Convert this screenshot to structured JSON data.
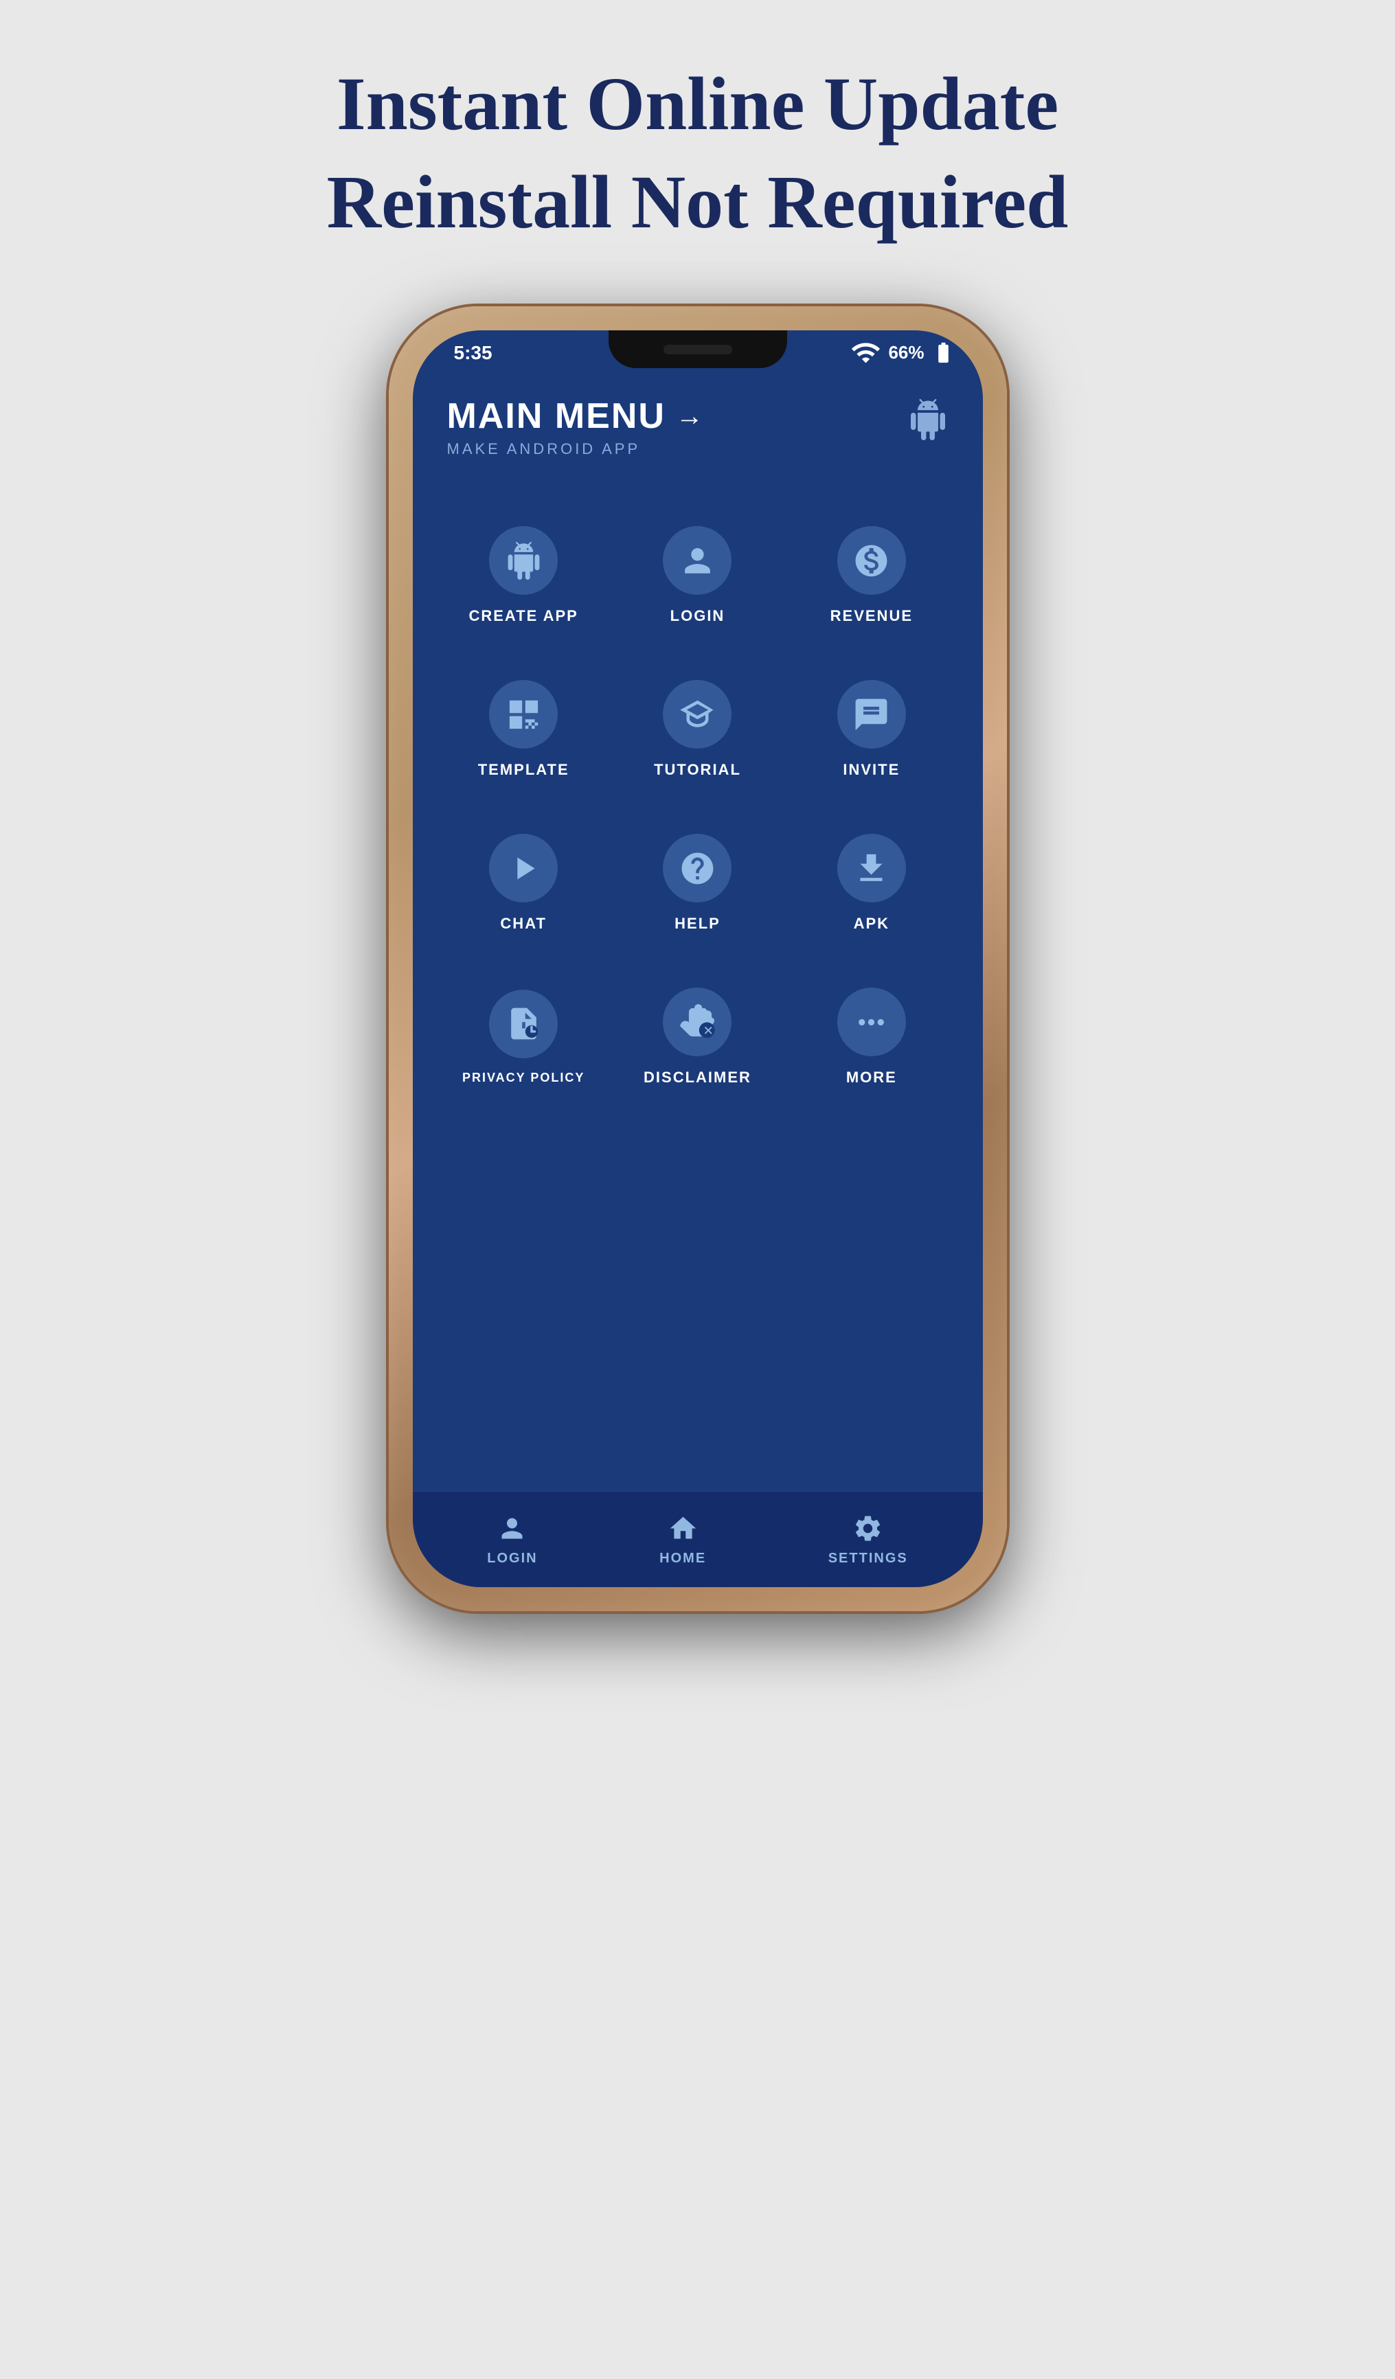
{
  "page": {
    "headline_line1": "Instant Online Update",
    "headline_line2": "Reinstall Not Required",
    "bg_color": "#e8e8e8",
    "text_color": "#1a2a5e"
  },
  "phone": {
    "status": {
      "time": "5:35",
      "battery": "66%"
    },
    "header": {
      "title": "MAIN MENU",
      "arrow": "→",
      "subtitle": "MAKE ANDROID APP"
    },
    "menu_items": [
      {
        "id": "create-app",
        "label": "CREATE APP",
        "icon": "android"
      },
      {
        "id": "login",
        "label": "LOGIN",
        "icon": "person"
      },
      {
        "id": "revenue",
        "label": "REVENUE",
        "icon": "dollar"
      },
      {
        "id": "template",
        "label": "TEMPLATE",
        "icon": "template"
      },
      {
        "id": "tutorial",
        "label": "TUTORIAL",
        "icon": "graduation"
      },
      {
        "id": "invite",
        "label": "INVITE",
        "icon": "chat-bubbles"
      },
      {
        "id": "chat",
        "label": "CHAT",
        "icon": "play"
      },
      {
        "id": "help",
        "label": "HELP",
        "icon": "question"
      },
      {
        "id": "apk",
        "label": "APK",
        "icon": "download"
      },
      {
        "id": "privacy-policy",
        "label": "PRIVACY POLICY",
        "icon": "privacy"
      },
      {
        "id": "disclaimer",
        "label": "DISCLAIMER",
        "icon": "hand-stop"
      },
      {
        "id": "more",
        "label": "MORE",
        "icon": "dots"
      }
    ],
    "bottom_nav": [
      {
        "id": "login-nav",
        "label": "LOGIN",
        "icon": "person"
      },
      {
        "id": "home-nav",
        "label": "HOME",
        "icon": "home"
      },
      {
        "id": "settings-nav",
        "label": "SETTINGS",
        "icon": "settings"
      }
    ]
  }
}
